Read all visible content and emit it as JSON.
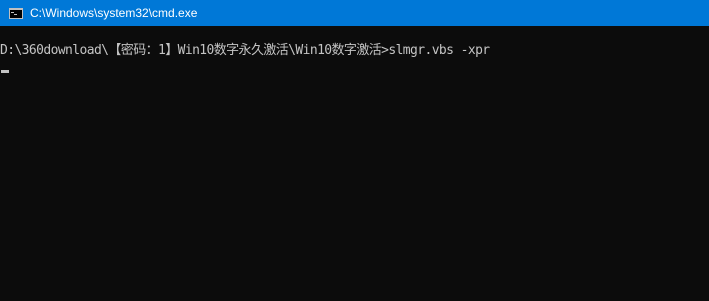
{
  "window": {
    "title": "C:\\Windows\\system32\\cmd.exe",
    "icon": "cmd-icon"
  },
  "console": {
    "lines": [
      "D:\\360download\\【密码：1】Win10数字永久激活\\Win10数字激活>slmgr.vbs -xpr"
    ]
  },
  "colors": {
    "titlebar": "#0078d7",
    "console_bg": "#0c0c0c",
    "console_text": "#c4c4c4"
  }
}
